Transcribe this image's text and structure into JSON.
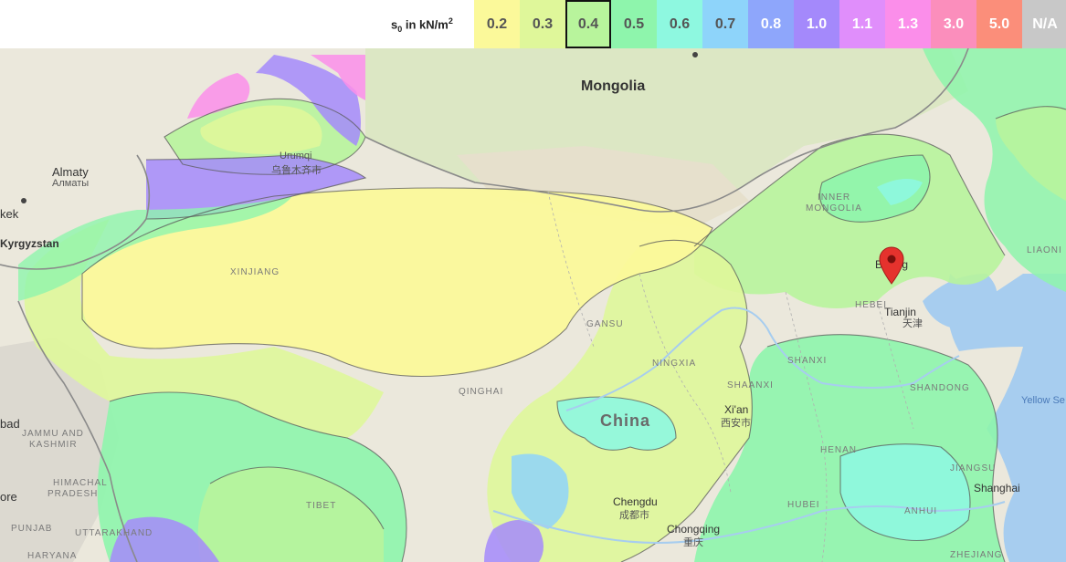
{
  "legend": {
    "title_prefix": "s",
    "title_sub": "0",
    "title_mid": " in kN/m",
    "title_sup": "2",
    "items": [
      {
        "label": "0.2",
        "color": "#fbf99a",
        "text": "#555"
      },
      {
        "label": "0.3",
        "color": "#dff79a",
        "text": "#555"
      },
      {
        "label": "0.4",
        "color": "#b8f49c",
        "text": "#555"
      },
      {
        "label": "0.5",
        "color": "#8ef5ac",
        "text": "#555"
      },
      {
        "label": "0.6",
        "color": "#8ef8e0",
        "text": "#555"
      },
      {
        "label": "0.7",
        "color": "#8ed4fa",
        "text": "#555"
      },
      {
        "label": "0.8",
        "color": "#8ea6fb",
        "text": "#fff"
      },
      {
        "label": "1.0",
        "color": "#a489fb",
        "text": "#fff"
      },
      {
        "label": "1.1",
        "color": "#e08efb",
        "text": "#fff"
      },
      {
        "label": "1.3",
        "color": "#fb8eea",
        "text": "#fff"
      },
      {
        "label": "3.0",
        "color": "#fb8ebc",
        "text": "#fff"
      },
      {
        "label": "5.0",
        "color": "#fb8e7a",
        "text": "#fff"
      },
      {
        "label": "N/A",
        "color": "#c8c8c8",
        "text": "#fff"
      }
    ],
    "selected_index": 2
  },
  "map": {
    "places": {
      "mongolia": "Mongolia",
      "china": "China",
      "almaty": "Almaty",
      "almaty_local": "Алматы",
      "kyrgyzstan": "Kyrgyzstan",
      "urumqi": "Urumqi",
      "urumqi_local": "乌鲁木齐市",
      "beijing": "Beijing",
      "tianjin": "Tianjin",
      "tianjin_local": "天津",
      "xian": "Xi'an",
      "xian_local": "西安市",
      "chengdu": "Chengdu",
      "chengdu_local": "成都市",
      "chongqing": "Chongqing",
      "chongqing_local": "重庆",
      "shanghai": "Shanghai",
      "yellow_sea": "Yellow Se",
      "bishkek_fragment": "kek",
      "islamabad_fragment": "bad",
      "delhi_fragment": "ore"
    },
    "regions": {
      "xinjiang": "XINJIANG",
      "inner_mongolia_1": "INNER",
      "inner_mongolia_2": "MONGOLIA",
      "gansu": "GANSU",
      "ningxia": "NINGXIA",
      "qinghai": "QINGHAI",
      "shaanxi": "SHAANXI",
      "shanxi": "SHANXI",
      "hebei": "HEBEI",
      "shandong": "SHANDONG",
      "henan": "HENAN",
      "jiangsu": "JIANGSU",
      "anhui": "ANHUI",
      "hubei": "HUBEI",
      "tibet": "TIBET",
      "zhejiang": "ZHEJIANG",
      "liaoning": "LIAONI",
      "jammu_1": "JAMMU AND",
      "jammu_2": "KASHMIR",
      "himachal_1": "HIMACHAL",
      "himachal_2": "PRADESH",
      "punjab": "PUNJAB",
      "uttarakhand": "UTTARAKHAND",
      "haryana": "HARYANA"
    }
  }
}
